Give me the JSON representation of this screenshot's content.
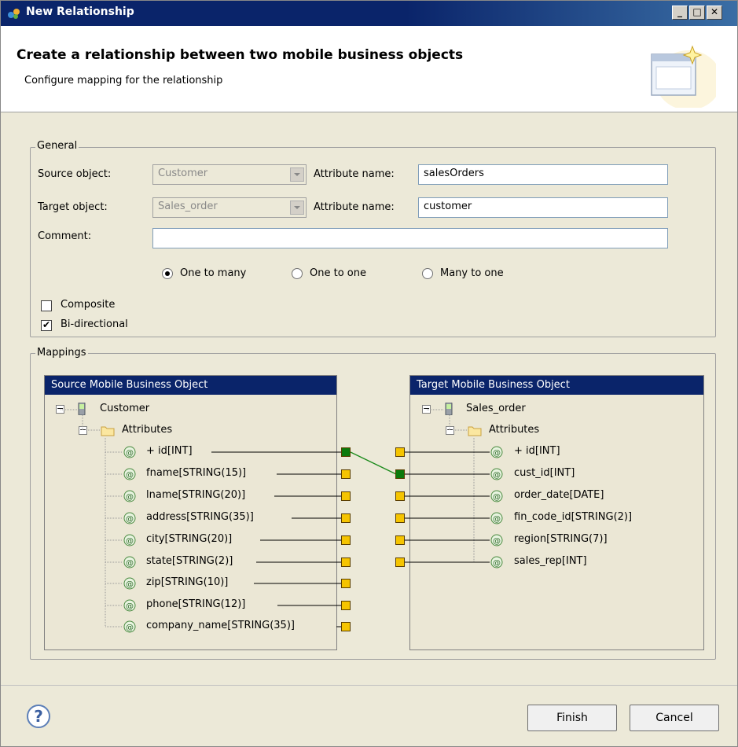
{
  "window": {
    "title": "New Relationship"
  },
  "header": {
    "title": "Create a relationship between two mobile business objects",
    "subtitle": "Configure mapping for the relationship"
  },
  "general": {
    "group_label": "General",
    "source_label": "Source object:",
    "source_value": "Customer",
    "target_label": "Target object:",
    "target_value": "Sales_order",
    "attr_label_1": "Attribute name:",
    "attr_value_1": "salesOrders",
    "attr_label_2": "Attribute name:",
    "attr_value_2": "customer",
    "comment_label": "Comment:",
    "comment_value": "",
    "radio_one_to_many": "One to many",
    "radio_one_to_one": "One to one",
    "radio_many_to_one": "Many to one",
    "selected_cardinality": "One to many",
    "composite_label": "Composite",
    "composite_checked": false,
    "bidirectional_label": "Bi-directional",
    "bidirectional_checked": true
  },
  "mappings": {
    "group_label": "Mappings",
    "source_panel": {
      "title": "Source Mobile Business Object",
      "root": "Customer",
      "folder": "Attributes",
      "attributes": [
        "+ id[INT]",
        "fname[STRING(15)]",
        "lname[STRING(20)]",
        "address[STRING(35)]",
        "city[STRING(20)]",
        "state[STRING(2)]",
        "zip[STRING(10)]",
        "phone[STRING(12)]",
        "company_name[STRING(35)]"
      ]
    },
    "target_panel": {
      "title": "Target Mobile Business Object",
      "root": "Sales_order",
      "folder": "Attributes",
      "attributes": [
        "+ id[INT]",
        "cust_id[INT]",
        "order_date[DATE]",
        "fin_code_id[STRING(2)]",
        "region[STRING(7)]",
        "sales_rep[INT]"
      ]
    },
    "mapping_color": "#1a8a1a",
    "connector_color": "#f5c400",
    "selected_connector_color": "#0b7a0b"
  },
  "footer": {
    "finish_label": "Finish",
    "cancel_label": "Cancel",
    "help_symbol": "?"
  },
  "colors": {
    "titlebar": "#0a246a",
    "panel_header": "#0a246a",
    "dialog_bg": "#ece9d8"
  }
}
